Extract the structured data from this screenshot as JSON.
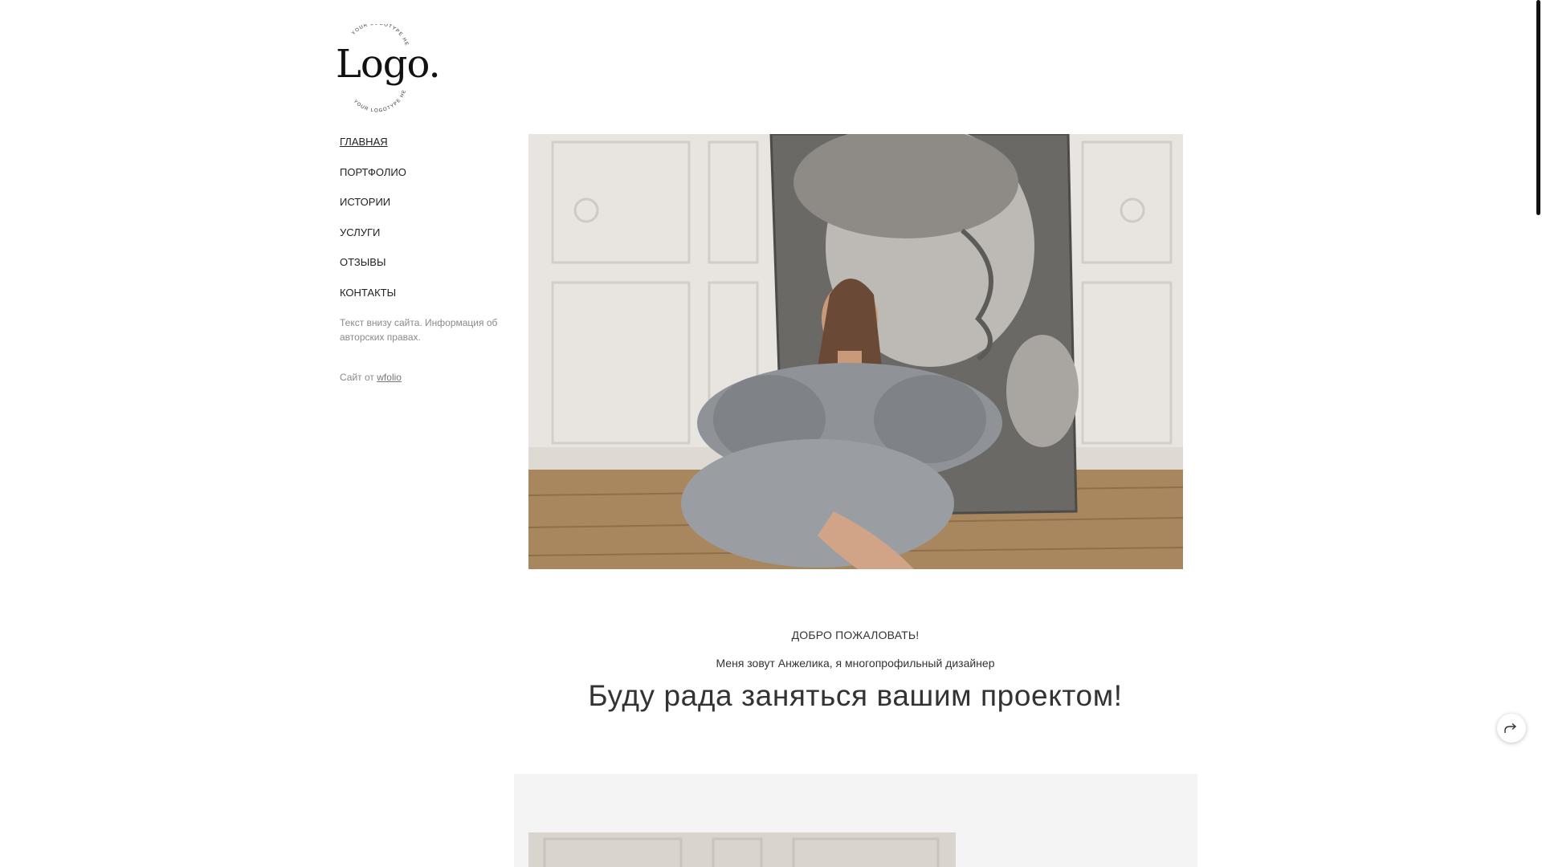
{
  "logo": {
    "word": "Logo.",
    "ring_top": "YOUR LOGOTYPE HERE",
    "ring_bottom": "YOUR LOGOTYPE HERE"
  },
  "nav": {
    "items": [
      {
        "label": "ГЛАВНАЯ",
        "active": true
      },
      {
        "label": "ПОРТФОЛИО",
        "active": false
      },
      {
        "label": "ИСТОРИИ",
        "active": false
      },
      {
        "label": "УСЛУГИ",
        "active": false
      },
      {
        "label": "ОТЗЫВЫ",
        "active": false
      },
      {
        "label": "КОНТАКТЫ",
        "active": false
      }
    ]
  },
  "sidebar": {
    "note": "Текст внизу сайта. Информация об авторских правах.",
    "credit_prefix": "Сайт от",
    "credit_link": "wfolio"
  },
  "hero": {
    "image": "photo-woman-grey-tulle-dress-david-statue"
  },
  "main": {
    "welcome": "ДОБРО ПОЖАЛОВАТЬ!",
    "intro": "Меня зовут Анжелика, я многопрофильный дизайнер",
    "tagline": "Буду рада заняться вашим проектом!"
  },
  "share": {
    "icon": "share-arrow-icon"
  },
  "colors": {
    "background": "#ffffff",
    "text": "#222222",
    "muted": "#8a8a8a",
    "section_bg": "#f4f4f4"
  }
}
